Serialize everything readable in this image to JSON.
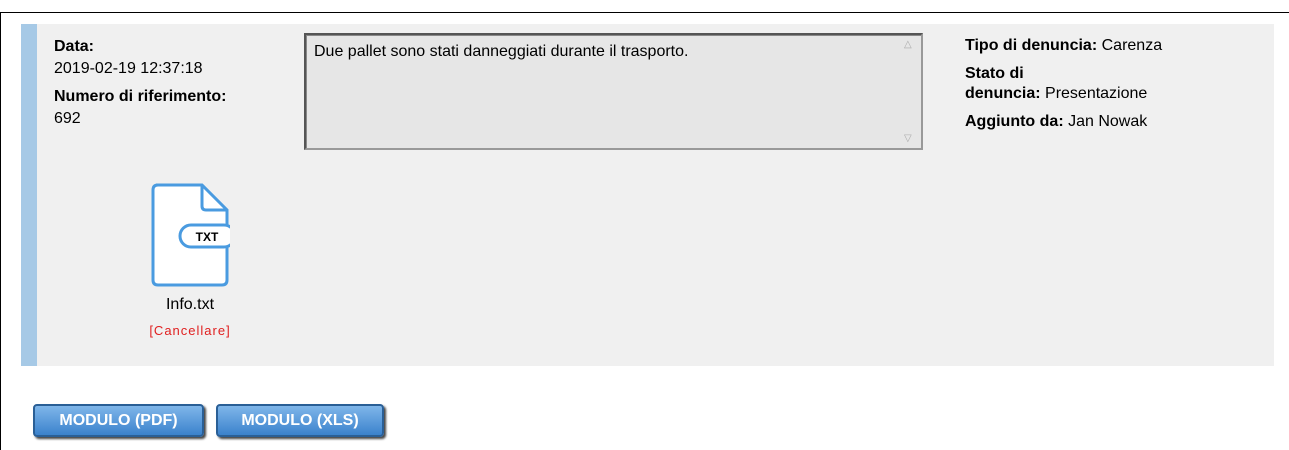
{
  "meta": {
    "date_label": "Data:",
    "date_value": "2019-02-19 12:37:18",
    "ref_label": "Numero di riferimento:",
    "ref_value": "692"
  },
  "description": {
    "text": "Due pallet sono stati danneggiati durante il trasporto."
  },
  "details": {
    "type_label": "Tipo di denuncia:",
    "type_value": "Carenza",
    "state_label_1": "Stato di",
    "state_label_2": "denuncia:",
    "state_value": "Presentazione",
    "added_label": "Aggiunto da:",
    "added_value": "Jan Nowak"
  },
  "attachment": {
    "icon": "txt-file-icon",
    "badge": "TXT",
    "filename": "Info.txt",
    "delete_label": "[Cancellare]"
  },
  "buttons": {
    "pdf_label": "MODULO (PDF)",
    "xls_label": "MODULO (XLS)"
  },
  "colors": {
    "accent_bar": "#a6c9e6",
    "panel_bg": "#f0f0f0",
    "icon_stroke": "#4a9be0",
    "delete_link": "#e02020",
    "button_bg": "#3b82cc"
  }
}
